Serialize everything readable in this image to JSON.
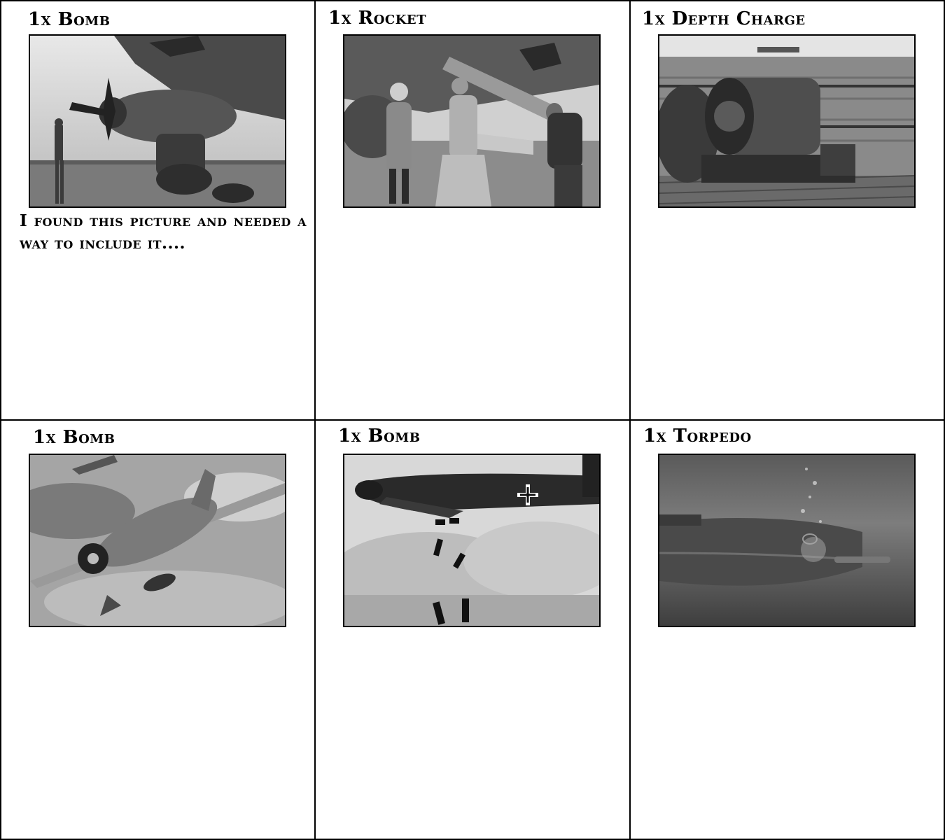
{
  "cards": [
    {
      "title": "1x Bomb",
      "note": "I found this picture and needed a way to include it....",
      "image_alt": "Ground crewman beside dive bomber propeller with bomb slung underneath"
    },
    {
      "title": "1x Rocket",
      "image_alt": "Officers and crew loading rocket beneath aircraft wing"
    },
    {
      "title": "1x Depth Charge",
      "image_alt": "Depth charge launcher drums on ship deck at sea"
    },
    {
      "title": "1x Bomb",
      "image_alt": "Fighter aircraft releasing bomb in combat painting"
    },
    {
      "title": "1x Bomb",
      "image_alt": "Bomber dropping bombs over smoke-covered ground"
    },
    {
      "title": "1x Torpedo",
      "image_alt": "Submarine launching torpedo underwater painting"
    }
  ]
}
